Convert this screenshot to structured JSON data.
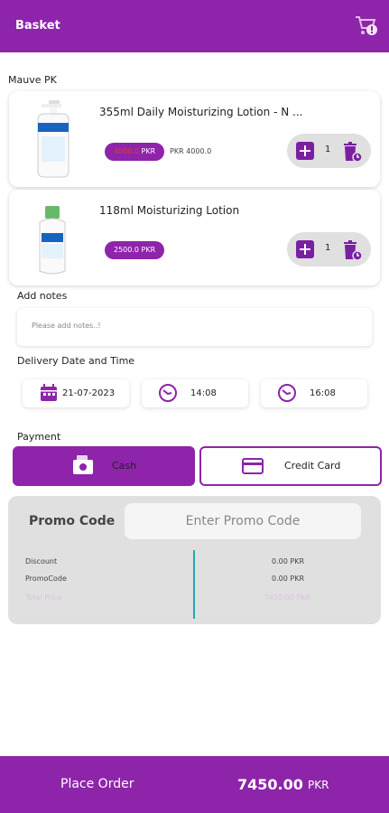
{
  "header": {
    "title": "Basket",
    "icon": "cart-icon"
  },
  "store": {
    "name": "Mauve PK"
  },
  "products": [
    {
      "name": "355ml Daily Moisturizing Lotion - N ...",
      "price_strike": "4000.0",
      "price_currency": "PKR",
      "old_price": "PKR 4000.0",
      "quantity": "1"
    },
    {
      "name": "118ml Moisturizing Lotion",
      "price": "2500.0  PKR",
      "quantity": "1"
    }
  ],
  "notes": {
    "label": "Add notes",
    "placeholder": "Please add notes..!"
  },
  "delivery": {
    "label": "Delivery Date and Time",
    "date": "21-07-2023",
    "time_from": "14:08",
    "time_to": "16:08"
  },
  "payment": {
    "label": "Payment",
    "cash_label": "Cash",
    "card_label": "Credit Card",
    "selected": "Cash"
  },
  "promo": {
    "title": "Promo Code",
    "placeholder": "Enter Promo Code",
    "rows": [
      {
        "label": "Discount",
        "value": "0.00 PKR"
      },
      {
        "label": "PromoCode",
        "value": "0.00 PKR"
      },
      {
        "label": "Total Price",
        "value": "7450.00 PKR"
      }
    ]
  },
  "footer": {
    "place_order": "Place Order",
    "total": "7450.00",
    "currency": "PKR"
  },
  "colors": {
    "primary": "#8e24aa",
    "accent_teal": "#26a6b4",
    "strike_red": "#e53935"
  }
}
